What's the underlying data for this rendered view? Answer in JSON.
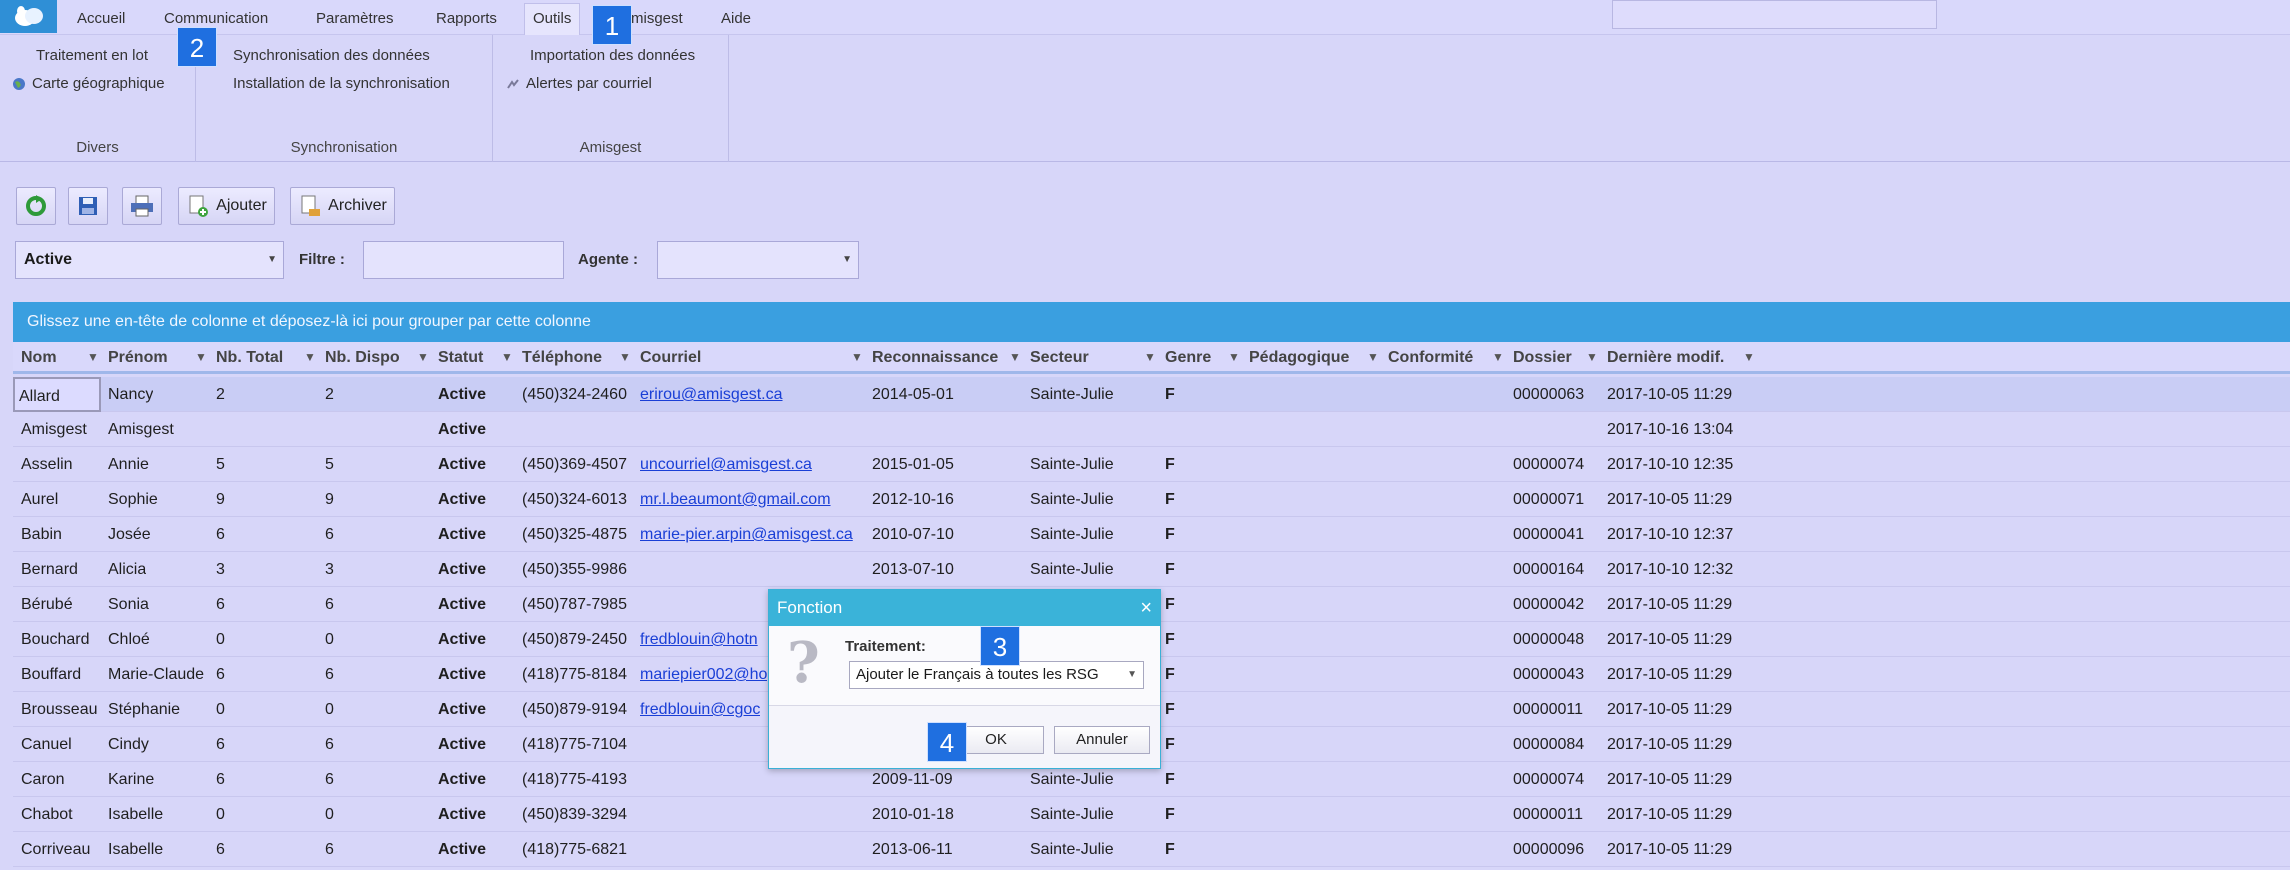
{
  "menu": {
    "items": [
      "Accueil",
      "Communication",
      "Paramètres",
      "Rapports",
      "Outils",
      "Amisgest",
      "Aide"
    ]
  },
  "ribbon": {
    "divers": {
      "label": "Divers",
      "batch": "Traitement en lot",
      "map": "Carte géographique"
    },
    "synchronisation": {
      "label": "Synchronisation",
      "sync": "Synchronisation des données",
      "install": "Installation de la synchronisation"
    },
    "amisgest": {
      "label": "Amisgest",
      "import": "Importation des données",
      "alerts": "Alertes par courriel"
    }
  },
  "toolbar": {
    "add_label": "Ajouter",
    "archive_label": "Archiver",
    "status_value": "Active",
    "filter_label": "Filtre :",
    "filter_value": "",
    "agent_label": "Agente :",
    "agent_value": ""
  },
  "groupbar": {
    "text": "Glissez une en-tête de colonne et déposez-là ici pour grouper par cette colonne"
  },
  "grid": {
    "columns": [
      "Nom",
      "Prénom",
      "Nb. Total",
      "Nb. Dispo",
      "Statut",
      "Téléphone",
      "Courriel",
      "Reconnaissance",
      "Secteur",
      "Genre",
      "Pédagogique",
      "Conformité",
      "Dossier",
      "Dernière modif."
    ],
    "rows": [
      [
        "Allard",
        "Nancy",
        "2",
        "2",
        "Active",
        "(450)324-2460",
        "erirou@amisgest.ca",
        "2014-05-01",
        "Sainte-Julie",
        "F",
        "",
        "",
        "00000063",
        "2017-10-05 11:29"
      ],
      [
        "Amisgest",
        "Amisgest",
        "",
        "",
        "Active",
        "",
        "",
        "",
        "",
        "",
        "",
        "",
        "",
        "2017-10-16 13:04"
      ],
      [
        "Asselin",
        "Annie",
        "5",
        "5",
        "Active",
        "(450)369-4507",
        "uncourriel@amisgest.ca",
        "2015-01-05",
        "Sainte-Julie",
        "F",
        "",
        "",
        "00000074",
        "2017-10-10 12:35"
      ],
      [
        "Aurel",
        "Sophie",
        "9",
        "9",
        "Active",
        "(450)324-6013",
        "mr.l.beaumont@gmail.com",
        "2012-10-16",
        "Sainte-Julie",
        "F",
        "",
        "",
        "00000071",
        "2017-10-05 11:29"
      ],
      [
        "Babin",
        "Josée",
        "6",
        "6",
        "Active",
        "(450)325-4875",
        "marie-pier.arpin@amisgest.ca",
        "2010-07-10",
        "Sainte-Julie",
        "F",
        "",
        "",
        "00000041",
        "2017-10-10 12:37"
      ],
      [
        "Bernard",
        "Alicia",
        "3",
        "3",
        "Active",
        "(450)355-9986",
        "",
        "2013-07-10",
        "Sainte-Julie",
        "F",
        "",
        "",
        "00000164",
        "2017-10-10 12:32"
      ],
      [
        "Bérubé",
        "Sonia",
        "6",
        "6",
        "Active",
        "(450)787-7985",
        "",
        "",
        "",
        "F",
        "",
        "",
        "00000042",
        "2017-10-05 11:29"
      ],
      [
        "Bouchard",
        "Chloé",
        "0",
        "0",
        "Active",
        "(450)879-2450",
        "fredblouin@hotn",
        "",
        "",
        "F",
        "",
        "",
        "00000048",
        "2017-10-05 11:29"
      ],
      [
        "Bouffard",
        "Marie-Claude",
        "6",
        "6",
        "Active",
        "(418)775-8184",
        "mariepier002@ho",
        "",
        "",
        "F",
        "",
        "",
        "00000043",
        "2017-10-05 11:29"
      ],
      [
        "Brousseau",
        "Stéphanie",
        "0",
        "0",
        "Active",
        "(450)879-9194",
        "fredblouin@cgoc",
        "",
        "",
        "F",
        "",
        "",
        "00000011",
        "2017-10-05 11:29"
      ],
      [
        "Canuel",
        "Cindy",
        "6",
        "6",
        "Active",
        "(418)775-7104",
        "",
        "",
        "",
        "F",
        "",
        "",
        "00000084",
        "2017-10-05 11:29"
      ],
      [
        "Caron",
        "Karine",
        "6",
        "6",
        "Active",
        "(418)775-4193",
        "",
        "2009-11-09",
        "Sainte-Julie",
        "F",
        "",
        "",
        "00000074",
        "2017-10-05 11:29"
      ],
      [
        "Chabot",
        "Isabelle",
        "0",
        "0",
        "Active",
        "(450)839-3294",
        "",
        "2010-01-18",
        "Sainte-Julie",
        "F",
        "",
        "",
        "00000011",
        "2017-10-05 11:29"
      ],
      [
        "Corriveau",
        "Isabelle",
        "6",
        "6",
        "Active",
        "(418)775-6821",
        "",
        "2013-06-11",
        "Sainte-Julie",
        "F",
        "",
        "",
        "00000096",
        "2017-10-05 11:29"
      ]
    ]
  },
  "dialog": {
    "title": "Fonction",
    "label": "Traitement:",
    "selected": "Ajouter le Français à toutes les RSG",
    "ok": "OK",
    "cancel": "Annuler"
  },
  "callouts": [
    "1",
    "2",
    "3",
    "4"
  ],
  "colors": {
    "background": "#d7d6f9",
    "accent_blue": "#3a9fe0",
    "dialog_title": "#3ab3d9",
    "callout": "#1f6fe0",
    "link": "#1a3fd6"
  }
}
